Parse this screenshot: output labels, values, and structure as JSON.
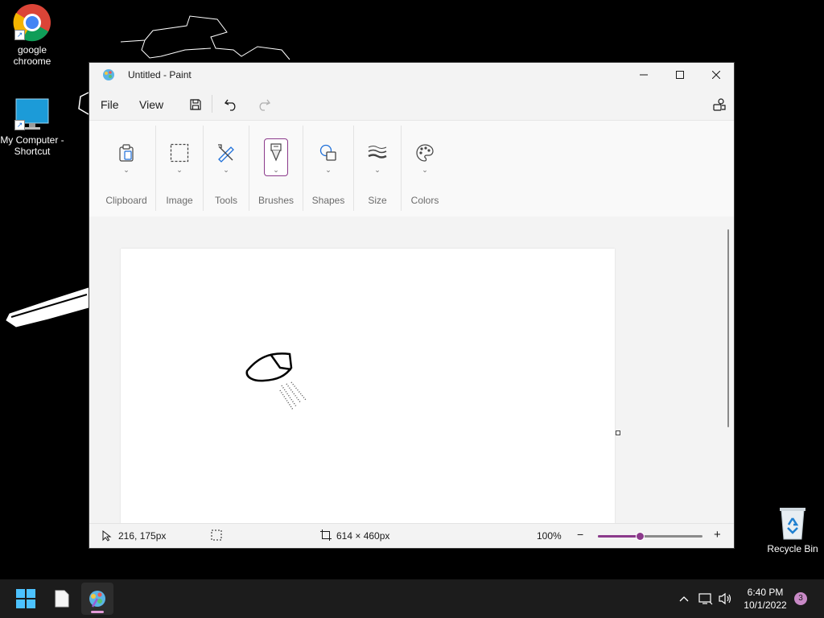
{
  "desktop": {
    "icons": [
      {
        "label": "google chroome"
      },
      {
        "label": "My Computer - Shortcut"
      },
      {
        "label": "Recycle Bin"
      }
    ]
  },
  "window": {
    "title": "Untitled - Paint",
    "menu": {
      "file": "File",
      "view": "View"
    },
    "ribbon": {
      "groups": [
        {
          "label": "Clipboard",
          "icon": "clipboard-icon"
        },
        {
          "label": "Image",
          "icon": "selection-icon"
        },
        {
          "label": "Tools",
          "icon": "tools-icon"
        },
        {
          "label": "Brushes",
          "icon": "brush-icon"
        },
        {
          "label": "Shapes",
          "icon": "shapes-icon"
        },
        {
          "label": "Size",
          "icon": "size-icon"
        },
        {
          "label": "Colors",
          "icon": "palette-icon"
        }
      ]
    },
    "status": {
      "cursor_pos": "216, 175px",
      "canvas_size": "614 × 460px",
      "zoom": "100%",
      "zoom_level": 0.4
    },
    "accent_color": "#8b3a8b"
  },
  "taskbar": {
    "time": "6:40 PM",
    "date": "10/1/2022",
    "notification_count": "3"
  }
}
